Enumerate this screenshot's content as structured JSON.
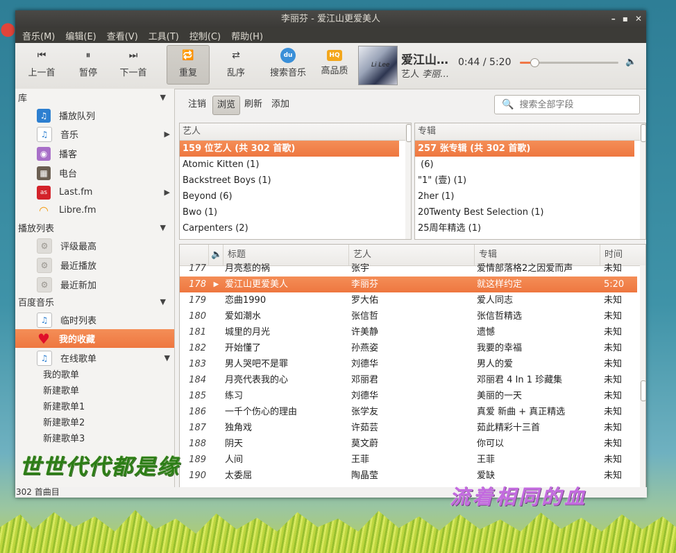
{
  "window": {
    "title": "李丽芬 - 爱江山更爱美人"
  },
  "menu": [
    "音乐(M)",
    "编辑(E)",
    "查看(V)",
    "工具(T)",
    "控制(C)",
    "帮助(H)"
  ],
  "toolbar": {
    "prev": "上一首",
    "pause": "暂停",
    "next": "下一首",
    "repeat": "重复",
    "shuffle": "乱序",
    "search_music": "搜索音乐",
    "hq": "高品质",
    "du_logo": "du",
    "hq_logo": "HQ"
  },
  "now_playing": {
    "title": "爱江山…",
    "artist_prefix": "艺人",
    "artist": "李丽…",
    "time": "0:44 / 5:20",
    "progress_fraction": 0.14
  },
  "sidebar": {
    "library": "库",
    "library_items": [
      "播放队列",
      "音乐",
      "播客",
      "电台",
      "Last.fm",
      "Libre.fm"
    ],
    "playlists": "播放列表",
    "playlist_items": [
      "评级最高",
      "最近播放",
      "最近新加"
    ],
    "baidu": "百度音乐",
    "baidu_items": [
      "临时列表",
      "我的收藏",
      "在线歌单"
    ],
    "online_lists": [
      "我的歌单",
      "新建歌单",
      "新建歌单1",
      "新建歌单2",
      "新建歌单3"
    ]
  },
  "browse_bar": {
    "logout": "注销",
    "browse": "浏览",
    "refresh": "刷新",
    "add": "添加",
    "search_placeholder": "搜索全部字段"
  },
  "artist_pane": {
    "header": "艺人",
    "rows": [
      "159 位艺人 (共 302 首歌)",
      "Atomic Kitten (1)",
      "Backstreet Boys (1)",
      "Beyond (6)",
      "Bwo (1)",
      "Carpenters (2)"
    ]
  },
  "album_pane": {
    "header": "专辑",
    "rows": [
      "257 张专辑 (共 302 首歌)",
      " (6)",
      "\"1\" (壹) (1)",
      "2her (1)",
      "20Twenty Best Selection (1)",
      "25周年精选 (1)"
    ]
  },
  "tracks": {
    "headers": {
      "title": "标题",
      "artist": "艺人",
      "album": "专辑",
      "time": "时间"
    },
    "rows": [
      {
        "no": "177",
        "title": "月亮惹的祸",
        "artist": "张宇",
        "album": "爱情部落格2之因爱而声",
        "time": "未知"
      },
      {
        "no": "178",
        "title": "爱江山更爱美人",
        "artist": "李丽芬",
        "album": "就这样约定",
        "time": "5:20",
        "playing": true
      },
      {
        "no": "179",
        "title": "恋曲1990",
        "artist": "罗大佑",
        "album": "爱人同志",
        "time": "未知"
      },
      {
        "no": "180",
        "title": "爱如潮水",
        "artist": "张信哲",
        "album": "张信哲精选",
        "time": "未知"
      },
      {
        "no": "181",
        "title": "城里的月光",
        "artist": "许美静",
        "album": "遗憾",
        "time": "未知"
      },
      {
        "no": "182",
        "title": "开始懂了",
        "artist": "孙燕姿",
        "album": "我要的幸福",
        "time": "未知"
      },
      {
        "no": "183",
        "title": "男人哭吧不是罪",
        "artist": "刘德华",
        "album": "男人的爱",
        "time": "未知"
      },
      {
        "no": "184",
        "title": "月亮代表我的心",
        "artist": "邓丽君",
        "album": "邓丽君 4 In 1 珍藏集",
        "time": "未知"
      },
      {
        "no": "185",
        "title": "练习",
        "artist": "刘德华",
        "album": "美丽的一天",
        "time": "未知"
      },
      {
        "no": "186",
        "title": "一千个伤心的理由",
        "artist": "张学友",
        "album": "真爱 新曲 + 真正精选",
        "time": "未知"
      },
      {
        "no": "187",
        "title": "独角戏",
        "artist": "许茹芸",
        "album": "茹此精彩十三首",
        "time": "未知"
      },
      {
        "no": "188",
        "title": "阴天",
        "artist": "莫文蔚",
        "album": "你可以",
        "time": "未知"
      },
      {
        "no": "189",
        "title": "人间",
        "artist": "王菲",
        "album": "王菲",
        "time": "未知"
      },
      {
        "no": "190",
        "title": "太委屈",
        "artist": "陶晶莹",
        "album": "爱缺",
        "time": "未知"
      }
    ]
  },
  "status": "302 首曲目",
  "overlay": {
    "left_text": "世世代代都是缘",
    "right_text": "流着相同的血"
  },
  "colors": {
    "accent": "#ef7b46",
    "titlebar": "#3c3b37"
  }
}
